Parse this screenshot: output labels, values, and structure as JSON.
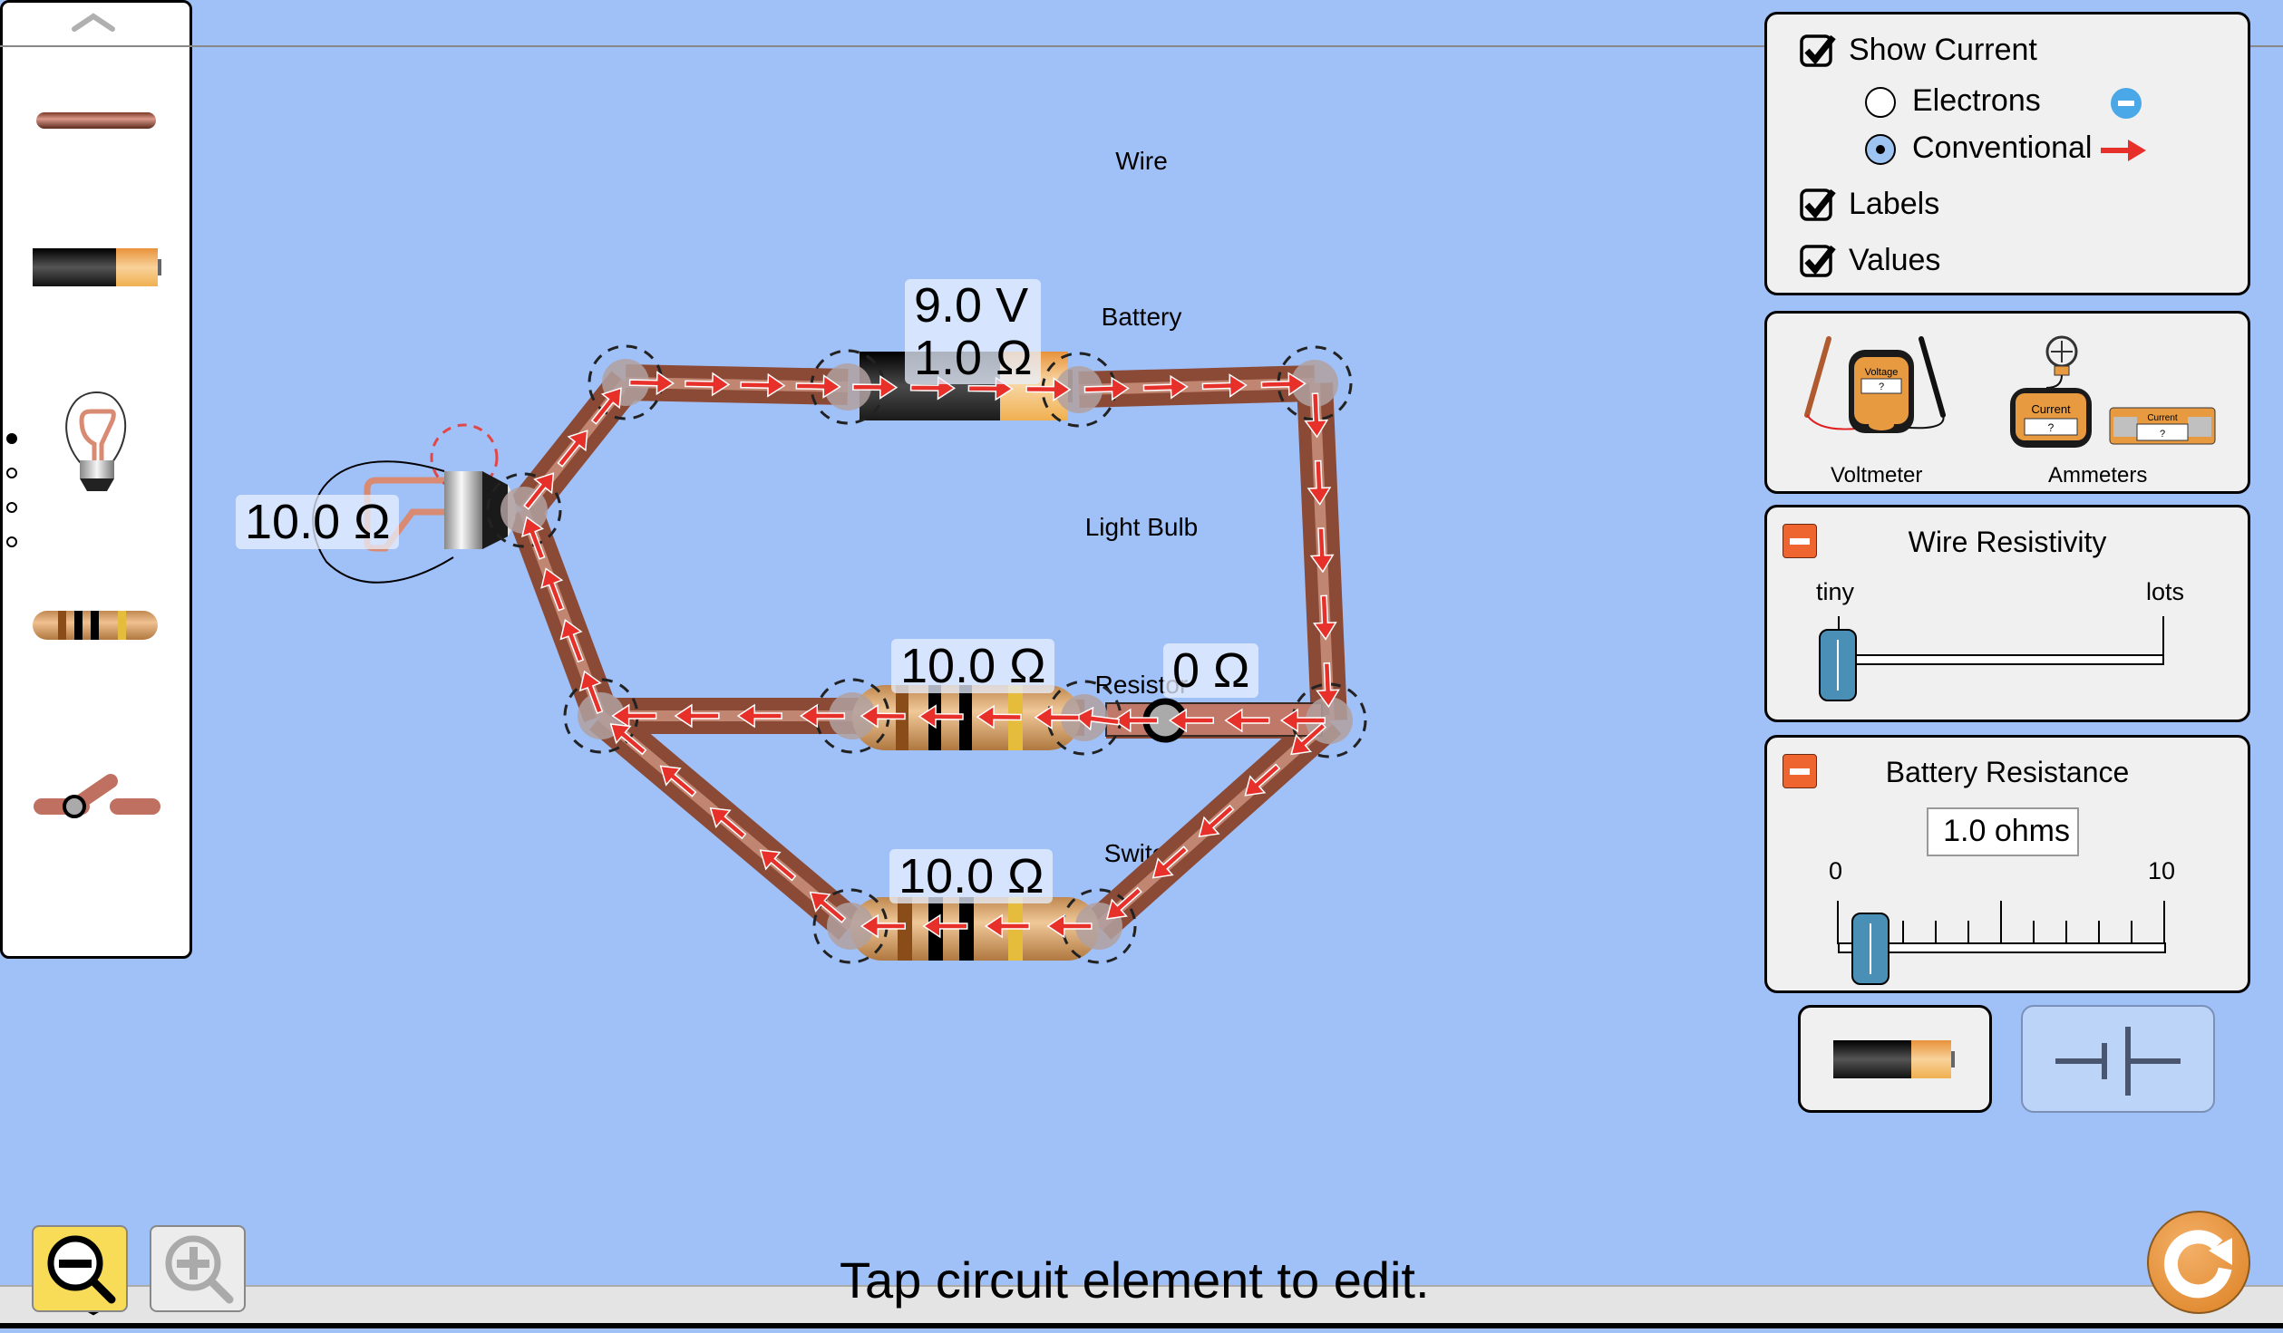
{
  "toolbox": {
    "items": [
      {
        "label": "Wire",
        "icon": "wire-icon"
      },
      {
        "label": "Battery",
        "icon": "battery-icon"
      },
      {
        "label": "Light Bulb",
        "icon": "light-bulb-icon"
      },
      {
        "label": "Resistor",
        "icon": "resistor-icon"
      },
      {
        "label": "Switch",
        "icon": "switch-icon"
      }
    ],
    "scroll_up_icon": "chevron-up-icon",
    "scroll_down_icon": "chevron-down-icon",
    "page_indicator": {
      "pages": 4,
      "current": 1
    }
  },
  "display_panel": {
    "show_current": {
      "label": "Show Current",
      "checked": true
    },
    "current_modes": [
      {
        "label": "Electrons",
        "selected": false,
        "icon": "electron-icon"
      },
      {
        "label": "Conventional",
        "selected": true,
        "icon": "red-arrow-icon"
      }
    ],
    "labels": {
      "label": "Labels",
      "checked": true
    },
    "values": {
      "label": "Values",
      "checked": true
    }
  },
  "meters_panel": {
    "voltmeter": {
      "label": "Voltmeter",
      "display_title": "Voltage",
      "display_value": "?"
    },
    "ammeters": {
      "label": "Ammeters",
      "probe_title": "Current",
      "probe_value": "?",
      "series_title": "Current",
      "series_value": "?"
    }
  },
  "wire_resistivity": {
    "title": "Wire Resistivity",
    "min_label": "tiny",
    "max_label": "lots",
    "value_fraction": 0.0
  },
  "battery_resistance": {
    "title": "Battery Resistance",
    "value_text": "1.0 ohms",
    "value": 1.0,
    "min_label": "0",
    "max_label": "10",
    "min": 0,
    "max": 10
  },
  "view_toggle": {
    "lifelike_icon": "battery-lifelike-icon",
    "schematic_icon": "battery-schematic-icon",
    "selected": "lifelike"
  },
  "circuit": {
    "battery": {
      "voltage_label": "9.0 V",
      "resistance_label": "1.0 Ω"
    },
    "light_bulb": {
      "resistance_label": "10.0 Ω"
    },
    "resistor_middle": {
      "resistance_label": "10.0 Ω"
    },
    "resistor_bottom": {
      "resistance_label": "10.0 Ω"
    },
    "switch": {
      "resistance_label": "0 Ω",
      "state": "closed"
    },
    "current_display": "conventional"
  },
  "zoom": {
    "zoom_out_icon": "zoom-out-icon",
    "zoom_in_icon": "zoom-in-icon"
  },
  "status_text": "Tap circuit element to edit.",
  "reset_icon": "reset-icon",
  "colors": {
    "background": "#a0c0f8",
    "panel": "#f0f0f0",
    "accent_orange": "#ee6530",
    "slider_thumb": "#4a8fb5",
    "current_arrow": "#e8302a",
    "reset": "#ec9a44",
    "zoom_out": "#f8dc58"
  }
}
